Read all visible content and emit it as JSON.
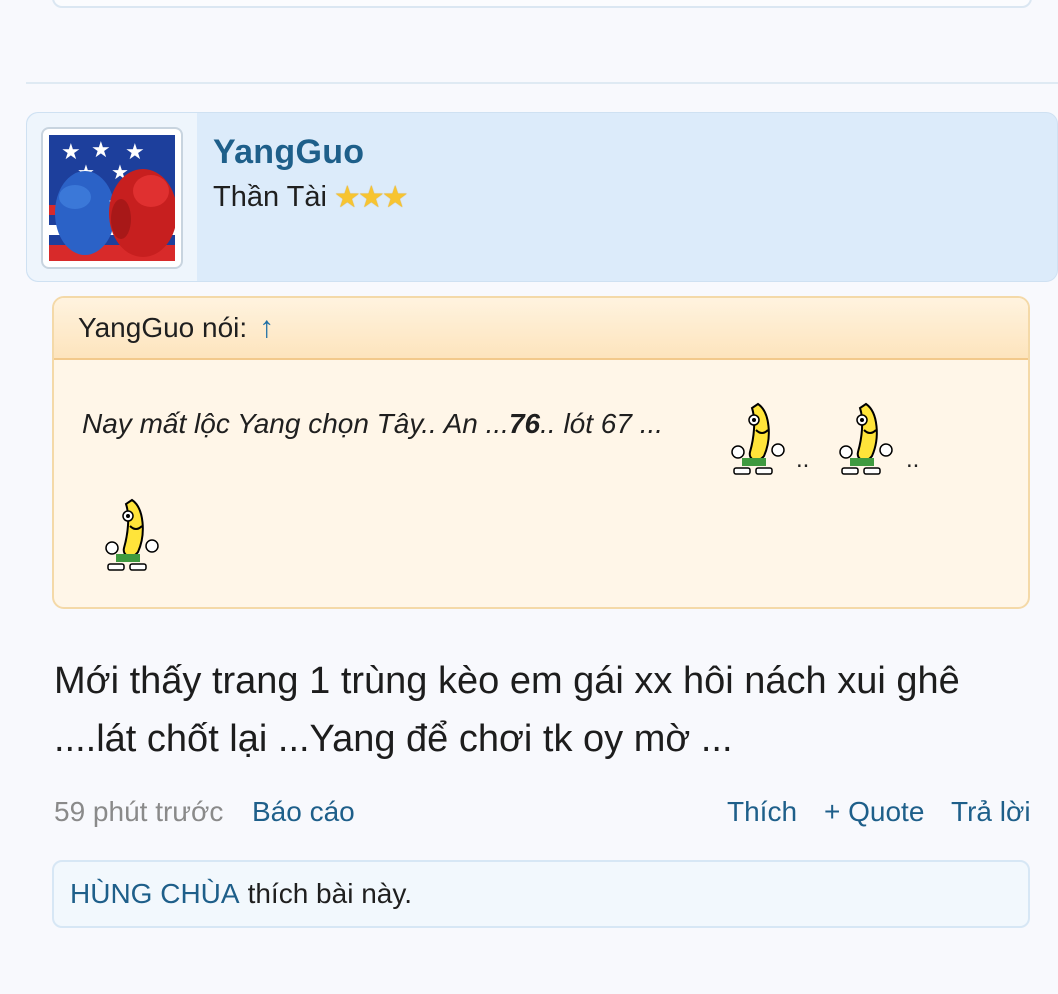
{
  "user": {
    "name": "YangGuo",
    "title": "Thần Tài",
    "stars": [
      "★",
      "★",
      "★"
    ]
  },
  "quote": {
    "header": "YangGuo nói:",
    "arrow": "↑",
    "text_before": "Nay mất lộc Yang chọn Tây.. An ...",
    "text_bold": "76",
    "text_after": ".. lót 67 ...",
    "dots": ".."
  },
  "post": {
    "message": "Mới thấy trang 1 trùng kèo em gái xx hôi nách xui ghê ....lát chốt lại ...Yang để chơi tk oy mờ ...",
    "time": "59 phút trước",
    "report": "Báo cáo",
    "like": "Thích",
    "quote": "+ Quote",
    "reply": "Trả lời"
  },
  "likes": {
    "liker": "HÙNG CHÙA",
    "suffix": "thích bài này."
  },
  "colors": {
    "link": "#1e5f8a",
    "header_bg": "#dcebfa",
    "quote_bg": "#fff6e8"
  }
}
